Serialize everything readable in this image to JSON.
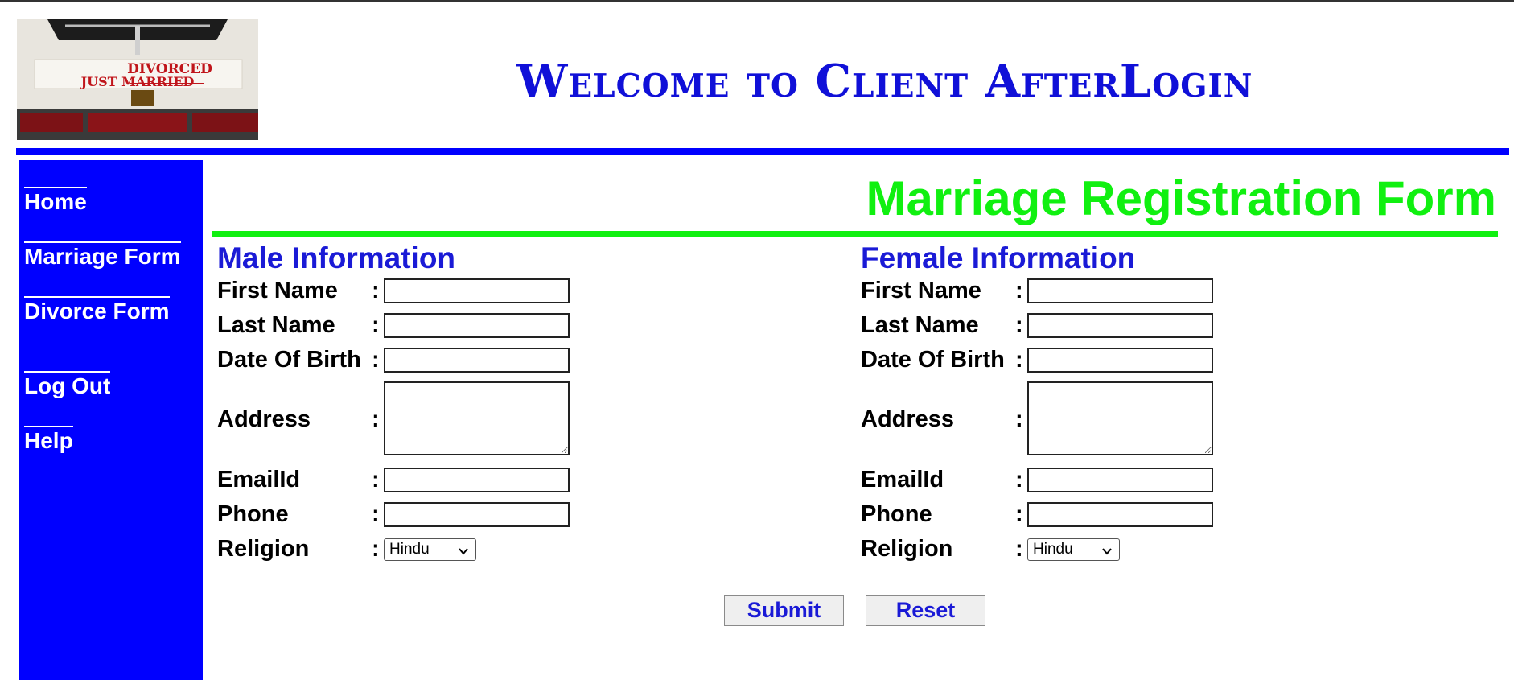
{
  "header": {
    "logo_sign_top": "DIVORCED",
    "logo_sign_bottom": "JUST MARRIED",
    "title": "Welcome to Client AfterLogin"
  },
  "sidebar": {
    "items": [
      {
        "label": "Home"
      },
      {
        "label": "Marriage Form"
      },
      {
        "label": "Divorce Form"
      },
      {
        "label": "Log Out"
      },
      {
        "label": "Help"
      }
    ]
  },
  "main": {
    "form_title": "Marriage Registration Form",
    "colon": ":",
    "male": {
      "heading": "Male Information",
      "fields": {
        "first_name": {
          "label": "First Name",
          "value": ""
        },
        "last_name": {
          "label": "Last Name",
          "value": ""
        },
        "dob": {
          "label": "Date Of Birth",
          "value": ""
        },
        "address": {
          "label": "Address",
          "value": ""
        },
        "email": {
          "label": "EmailId",
          "value": ""
        },
        "phone": {
          "label": "Phone",
          "value": ""
        },
        "religion": {
          "label": "Religion",
          "selected": "Hindu"
        }
      }
    },
    "female": {
      "heading": "Female Information",
      "fields": {
        "first_name": {
          "label": "First Name",
          "value": ""
        },
        "last_name": {
          "label": "Last Name",
          "value": ""
        },
        "dob": {
          "label": "Date Of Birth",
          "value": ""
        },
        "address": {
          "label": "Address",
          "value": ""
        },
        "email": {
          "label": "EmailId",
          "value": ""
        },
        "phone": {
          "label": "Phone",
          "value": ""
        },
        "religion": {
          "label": "Religion",
          "selected": "Hindu"
        }
      }
    },
    "buttons": {
      "submit": "Submit",
      "reset": "Reset"
    }
  },
  "colors": {
    "primary_blue": "#0000ff",
    "heading_blue": "#1a1ad6",
    "accent_green": "#10f010"
  }
}
